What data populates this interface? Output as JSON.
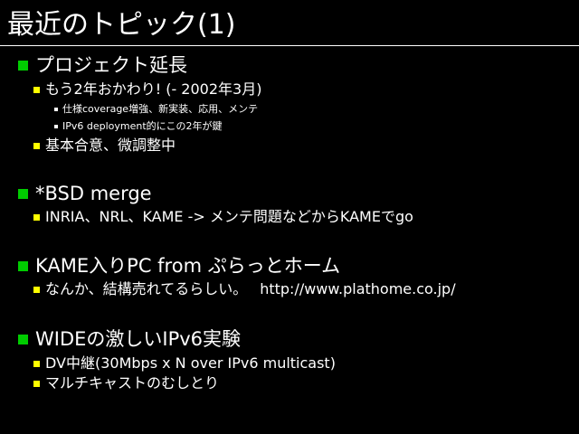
{
  "slide": {
    "title": "最近のトピック(1)",
    "colors": {
      "background": "#000000",
      "text": "#ffffff",
      "bullet_level1": "#00cc00",
      "bullet_level2": "#ffff00",
      "bullet_level3": "#ffffff"
    },
    "sections": [
      {
        "heading": "プロジェクト延長",
        "items": [
          {
            "text": "もう2年おかわり! (- 2002年3月)",
            "subitems": [
              "仕様coverage増強、新実装、応用、メンテ",
              "IPv6 deployment的にこの2年が鍵"
            ]
          },
          {
            "text": "基本合意、微調整中"
          }
        ]
      },
      {
        "heading": "*BSD merge",
        "items": [
          {
            "text": "INRIA、NRL、KAME -> メンテ問題などからKAMEでgo"
          }
        ]
      },
      {
        "heading": "KAME入りPC from ぷらっとホーム",
        "items": [
          {
            "text": "なんか、結構売れてるらしい。",
            "url": "http://www.plathome.co.jp/"
          }
        ]
      },
      {
        "heading": "WIDEの激しいIPv6実験",
        "items": [
          {
            "text": "DV中継(30Mbps x N over IPv6 multicast)"
          },
          {
            "text": "マルチキャストのむしとり"
          }
        ]
      }
    ]
  }
}
